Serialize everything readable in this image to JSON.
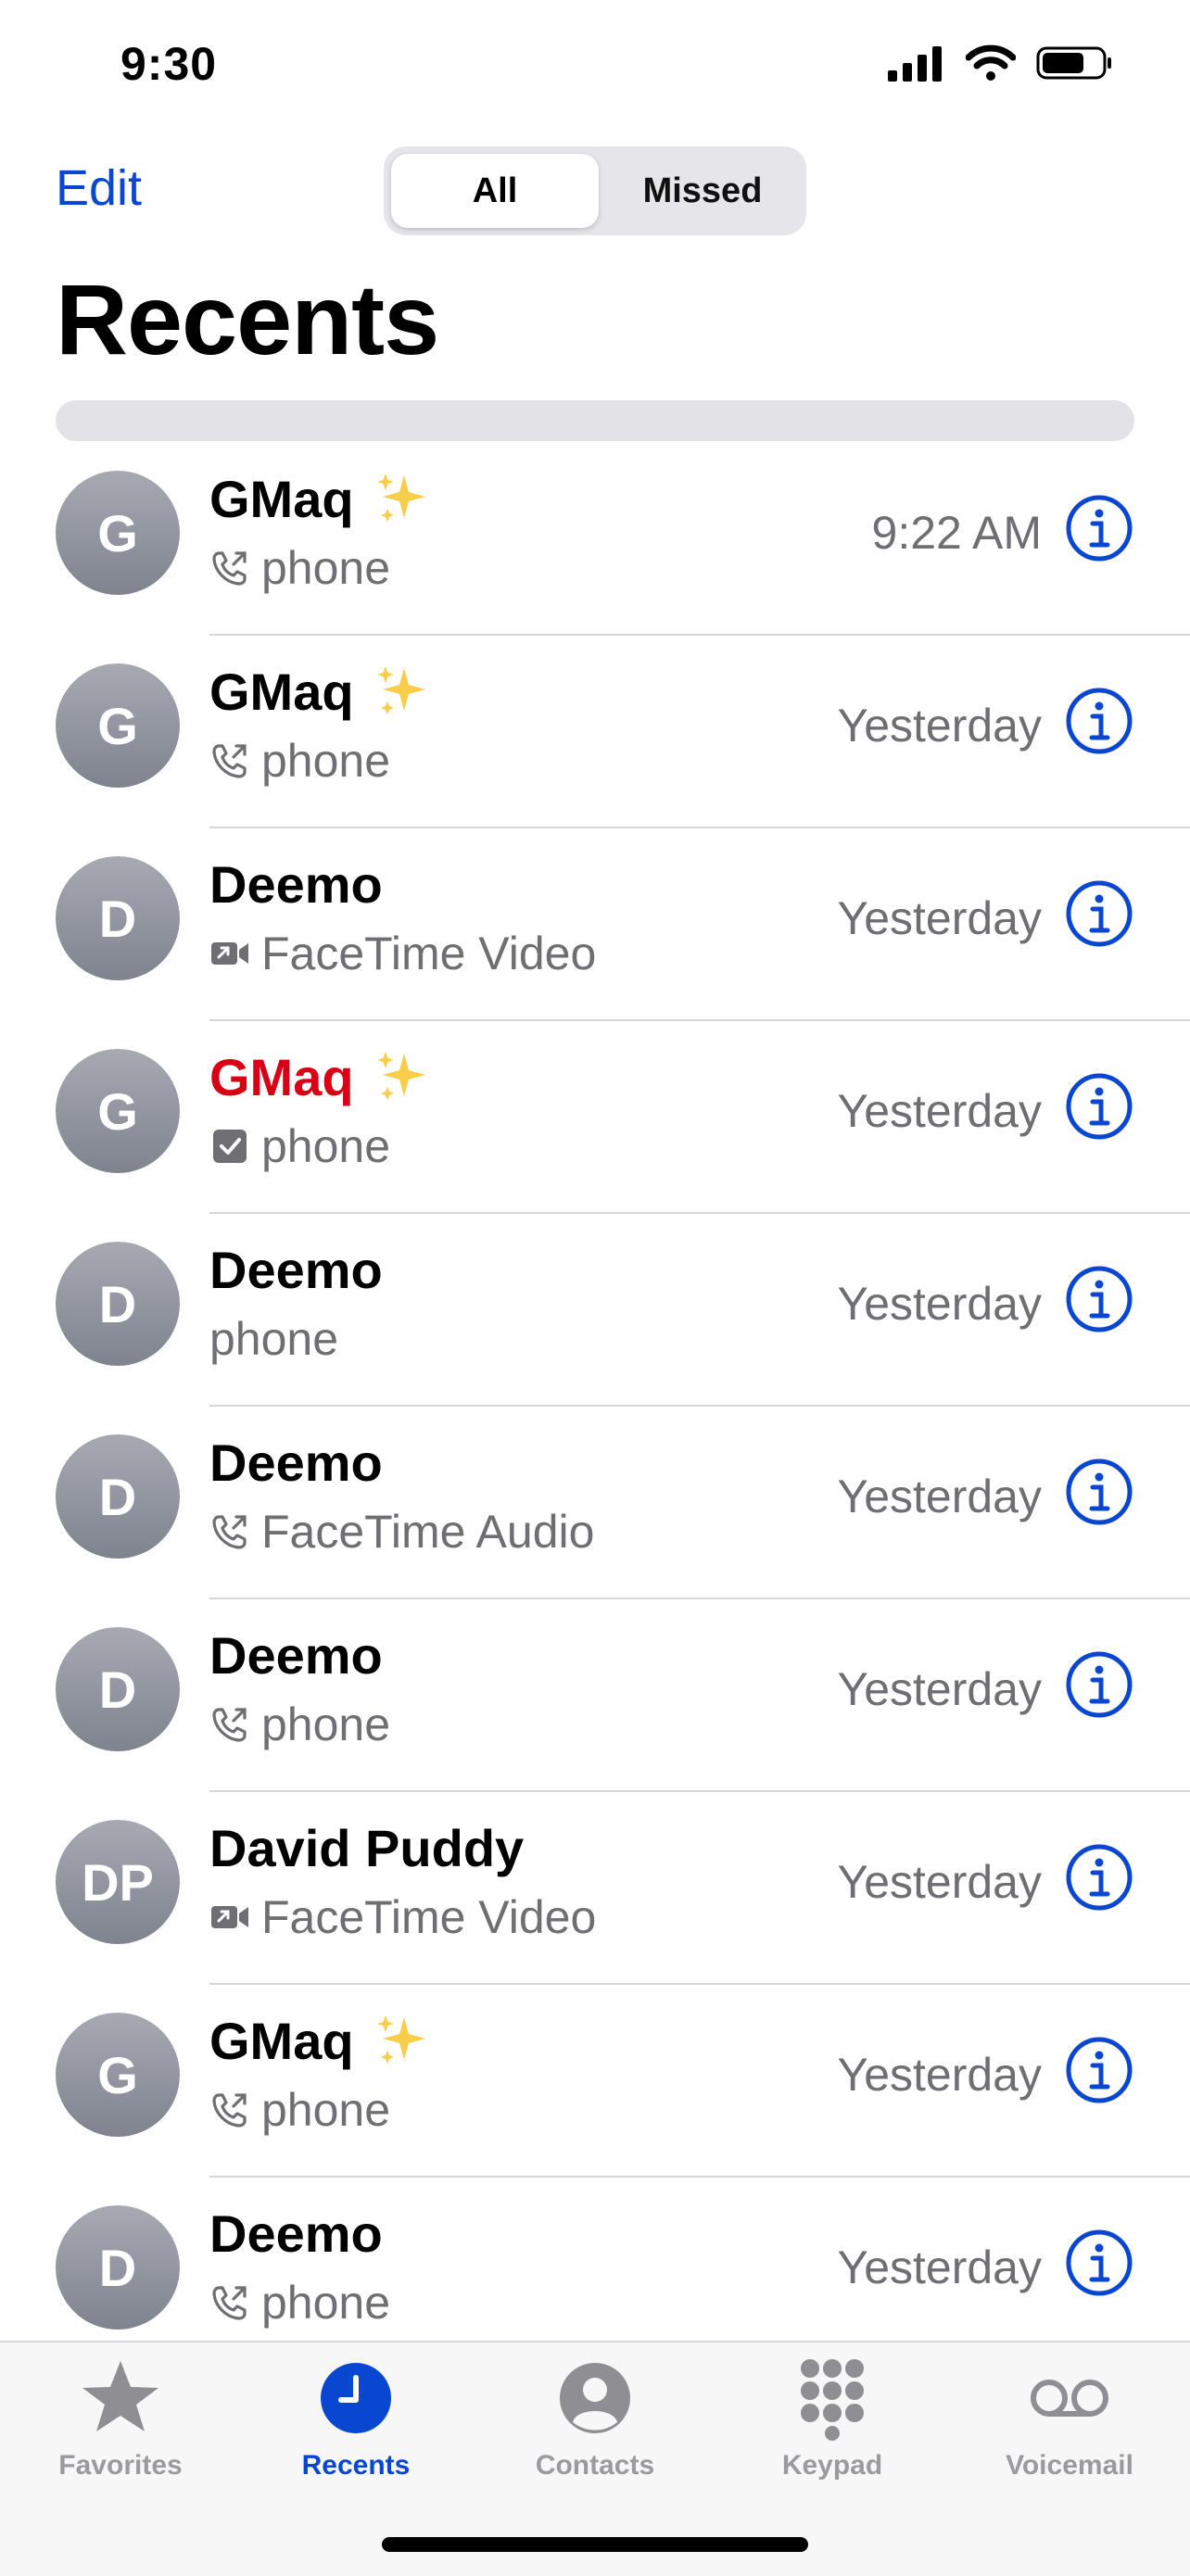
{
  "status": {
    "time": "9:30"
  },
  "header": {
    "edit_label": "Edit",
    "segments": [
      "All",
      "Missed"
    ],
    "selected_segment": "All",
    "title": "Recents"
  },
  "calls": [
    {
      "initials": "G",
      "name": "GMaq",
      "sparkle": true,
      "missed": false,
      "type_icon": "outgoing-call-icon",
      "type": "phone",
      "time": "9:22 AM"
    },
    {
      "initials": "G",
      "name": "GMaq",
      "sparkle": true,
      "missed": false,
      "type_icon": "outgoing-call-icon",
      "type": "phone",
      "time": "Yesterday"
    },
    {
      "initials": "D",
      "name": "Deemo",
      "sparkle": false,
      "missed": false,
      "type_icon": "video-call-icon",
      "type": "FaceTime Video",
      "time": "Yesterday"
    },
    {
      "initials": "G",
      "name": "GMaq",
      "sparkle": true,
      "missed": true,
      "type_icon": "checkbox-icon",
      "type": "phone",
      "time": "Yesterday"
    },
    {
      "initials": "D",
      "name": "Deemo",
      "sparkle": false,
      "missed": false,
      "type_icon": "",
      "type": "phone",
      "time": "Yesterday"
    },
    {
      "initials": "D",
      "name": "Deemo",
      "sparkle": false,
      "missed": false,
      "type_icon": "outgoing-call-icon",
      "type": "FaceTime Audio",
      "time": "Yesterday"
    },
    {
      "initials": "D",
      "name": "Deemo",
      "sparkle": false,
      "missed": false,
      "type_icon": "outgoing-call-icon",
      "type": "phone",
      "time": "Yesterday"
    },
    {
      "initials": "DP",
      "name": "David Puddy",
      "sparkle": false,
      "missed": false,
      "type_icon": "video-call-icon",
      "type": "FaceTime Video",
      "time": "Yesterday"
    },
    {
      "initials": "G",
      "name": "GMaq",
      "sparkle": true,
      "missed": false,
      "type_icon": "outgoing-call-icon",
      "type": "phone",
      "time": "Yesterday"
    },
    {
      "initials": "D",
      "name": "Deemo",
      "sparkle": false,
      "missed": false,
      "type_icon": "outgoing-call-icon",
      "type": "phone",
      "time": "Yesterday"
    }
  ],
  "tabbar": {
    "items": [
      {
        "label": "Favorites",
        "icon": "star-icon",
        "active": false
      },
      {
        "label": "Recents",
        "icon": "clock-icon",
        "active": true
      },
      {
        "label": "Contacts",
        "icon": "person-icon",
        "active": false
      },
      {
        "label": "Keypad",
        "icon": "keypad-icon",
        "active": false
      },
      {
        "label": "Voicemail",
        "icon": "voicemail-icon",
        "active": false
      }
    ]
  },
  "colors": {
    "accent": "#0a47d1",
    "missed": "#d70015",
    "secondary_text": "#6e6e73"
  }
}
